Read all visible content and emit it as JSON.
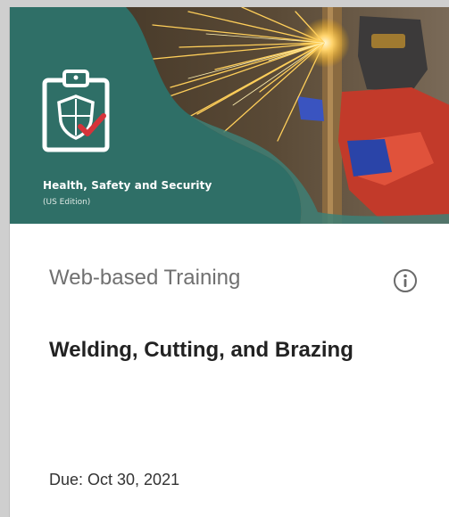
{
  "card": {
    "banner_title": "Health, Safety and Security",
    "banner_subtitle": "(US Edition)",
    "category": "Web-based Training",
    "course_title": "Welding, Cutting, and Brazing",
    "due": "Due: Oct 30, 2021"
  },
  "icons": {
    "banner": "clipboard-shield-check-icon",
    "info": "info-icon"
  },
  "colors": {
    "teal": "#2f6f67",
    "check": "#d6333a",
    "background": "#ffffff"
  }
}
